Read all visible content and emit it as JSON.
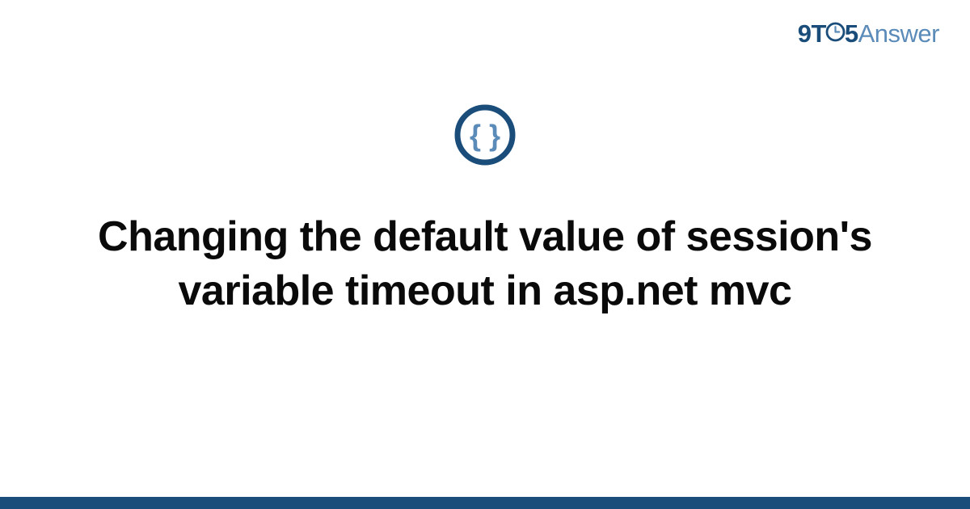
{
  "logo": {
    "nine": "9",
    "t": "T",
    "five": "5",
    "answer": "Answer"
  },
  "heading": "Changing the default value of session's variable timeout in asp.net mvc",
  "colors": {
    "brand_dark": "#1a4d7a",
    "brand_light": "#5b8bb8",
    "text": "#0a0a0a"
  }
}
